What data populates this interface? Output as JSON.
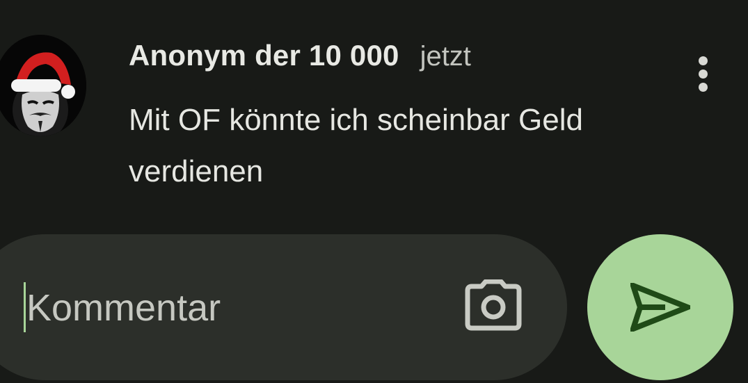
{
  "comment": {
    "author": "Anonym der 10 000",
    "time": "jetzt",
    "text": "Mit OF könnte ich scheinbar Geld verdienen",
    "avatar_icon": "santa-hat-mask-avatar",
    "menu_icon": "more-vert-icon"
  },
  "composer": {
    "placeholder": "Kommentar",
    "value": "",
    "camera_icon": "camera-icon",
    "send_icon": "send-icon"
  },
  "colors": {
    "background": "#181a17",
    "input_background": "#2c2f2a",
    "accent": "#a8d599",
    "send_icon": "#1f4a17",
    "text_primary": "#e6e7e2"
  }
}
